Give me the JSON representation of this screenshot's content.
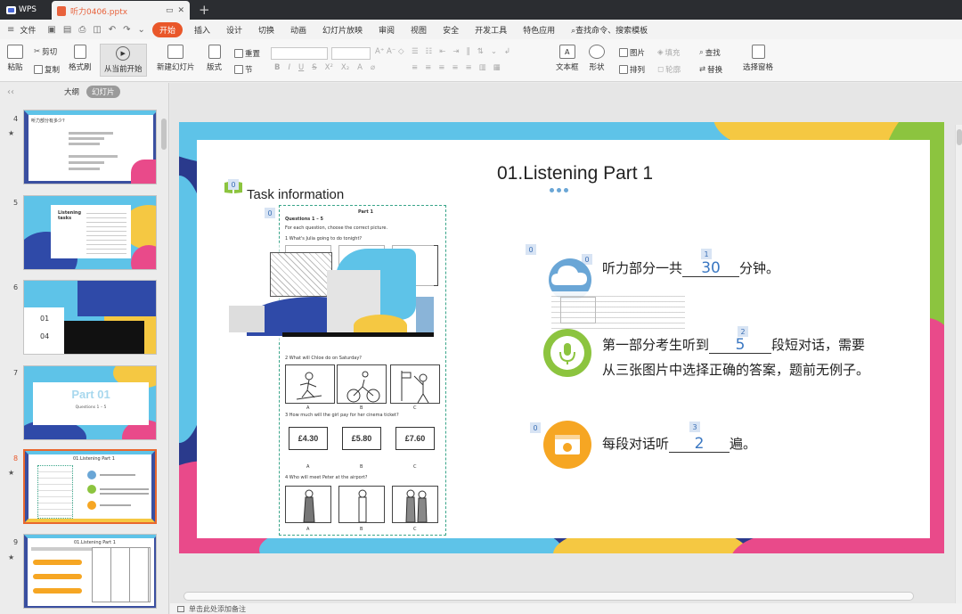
{
  "titlebar": {
    "app": "WPS",
    "doc_title": "听力0406.pptx"
  },
  "menubar": {
    "file": "文件",
    "tabs": [
      "开始",
      "插入",
      "设计",
      "切换",
      "动画",
      "幻灯片放映",
      "审阅",
      "视图",
      "安全",
      "开发工具",
      "特色应用"
    ],
    "active_tab": "开始",
    "search": "查找命令、搜索模板"
  },
  "ribbon": {
    "paste": "粘贴",
    "cut": "剪切",
    "copy": "复制",
    "format_painter": "格式刷",
    "from_current": "从当前开始",
    "new_slide": "新建幻灯片",
    "layout": "版式",
    "section": "节",
    "reset": "重置",
    "textbox": "文本框",
    "shape": "形状",
    "picture": "图片",
    "arrange": "排列",
    "fill": "填充",
    "outline": "轮廓",
    "find": "查找",
    "replace": "替换",
    "select_pane": "选择窗格"
  },
  "leftpanel": {
    "tab_outline": "大纲",
    "tab_slides": "幻灯片",
    "thumbs": [
      {
        "num": "4",
        "starred": true,
        "text": "听力部分有多少?"
      },
      {
        "num": "5",
        "starred": false,
        "text": "Listening tasks"
      },
      {
        "num": "6",
        "starred": false,
        "text": "01 04"
      },
      {
        "num": "7",
        "starred": false,
        "text": "Part 01"
      },
      {
        "num": "8",
        "starred": true,
        "text": "01.Listening Part 1"
      },
      {
        "num": "9",
        "starred": true,
        "text": "01.Listening Part 1"
      }
    ],
    "thumb6_a": "01",
    "thumb6_b": "04",
    "thumb7_title": "Part 01",
    "thumb7_sub": "Questions 1 – 5",
    "thumb4_title": "听力部分有多少?",
    "thumb5_title": "Listening tasks",
    "thumb8_title": "01.Listening Part 1",
    "thumb9_title": "01.Listening Part 1"
  },
  "slide": {
    "title": "01.Listening Part 1",
    "task_info": "Task information",
    "line1_pre": "听力部分一共",
    "line1_val": "30",
    "line1_post": "分钟。",
    "line2_pre": "第一部分考生听到",
    "line2_val": "5",
    "line2_post": "段短对话，需要",
    "line3": "从三张图片中选择正确的答案，题前无例子。",
    "line4_pre": "每段对话听",
    "line4_val": "2",
    "line4_post": "遍。",
    "badges": {
      "book": "0",
      "sheet": "0",
      "q1_icon": "0",
      "q1_cloud": "0",
      "q1_blank": "1",
      "q2_blank": "2",
      "q3_icon": "0",
      "q3_blank": "3"
    },
    "worksheet": {
      "part": "Part 1",
      "questions": "Questions 1 – 5",
      "instruction": "For each question, choose the correct picture.",
      "q1": "What's Julia going to do tonight?",
      "q2": "What will Chloe do on Saturday?",
      "q3": "How much will the girl pay for her cinema ticket?",
      "q4": "Who will meet Peter at the airport?",
      "prices": [
        "£4.30",
        "£5.80",
        "£7.60"
      ],
      "abc": [
        "A",
        "B",
        "C"
      ]
    }
  },
  "statusbar": {
    "notes": "单击此处添加备注"
  },
  "colors": {
    "accent": "#e9572a",
    "title_bg": "#2b2d31",
    "blue": "#3b78c2",
    "green": "#8cc43f",
    "orange": "#f6a623"
  }
}
